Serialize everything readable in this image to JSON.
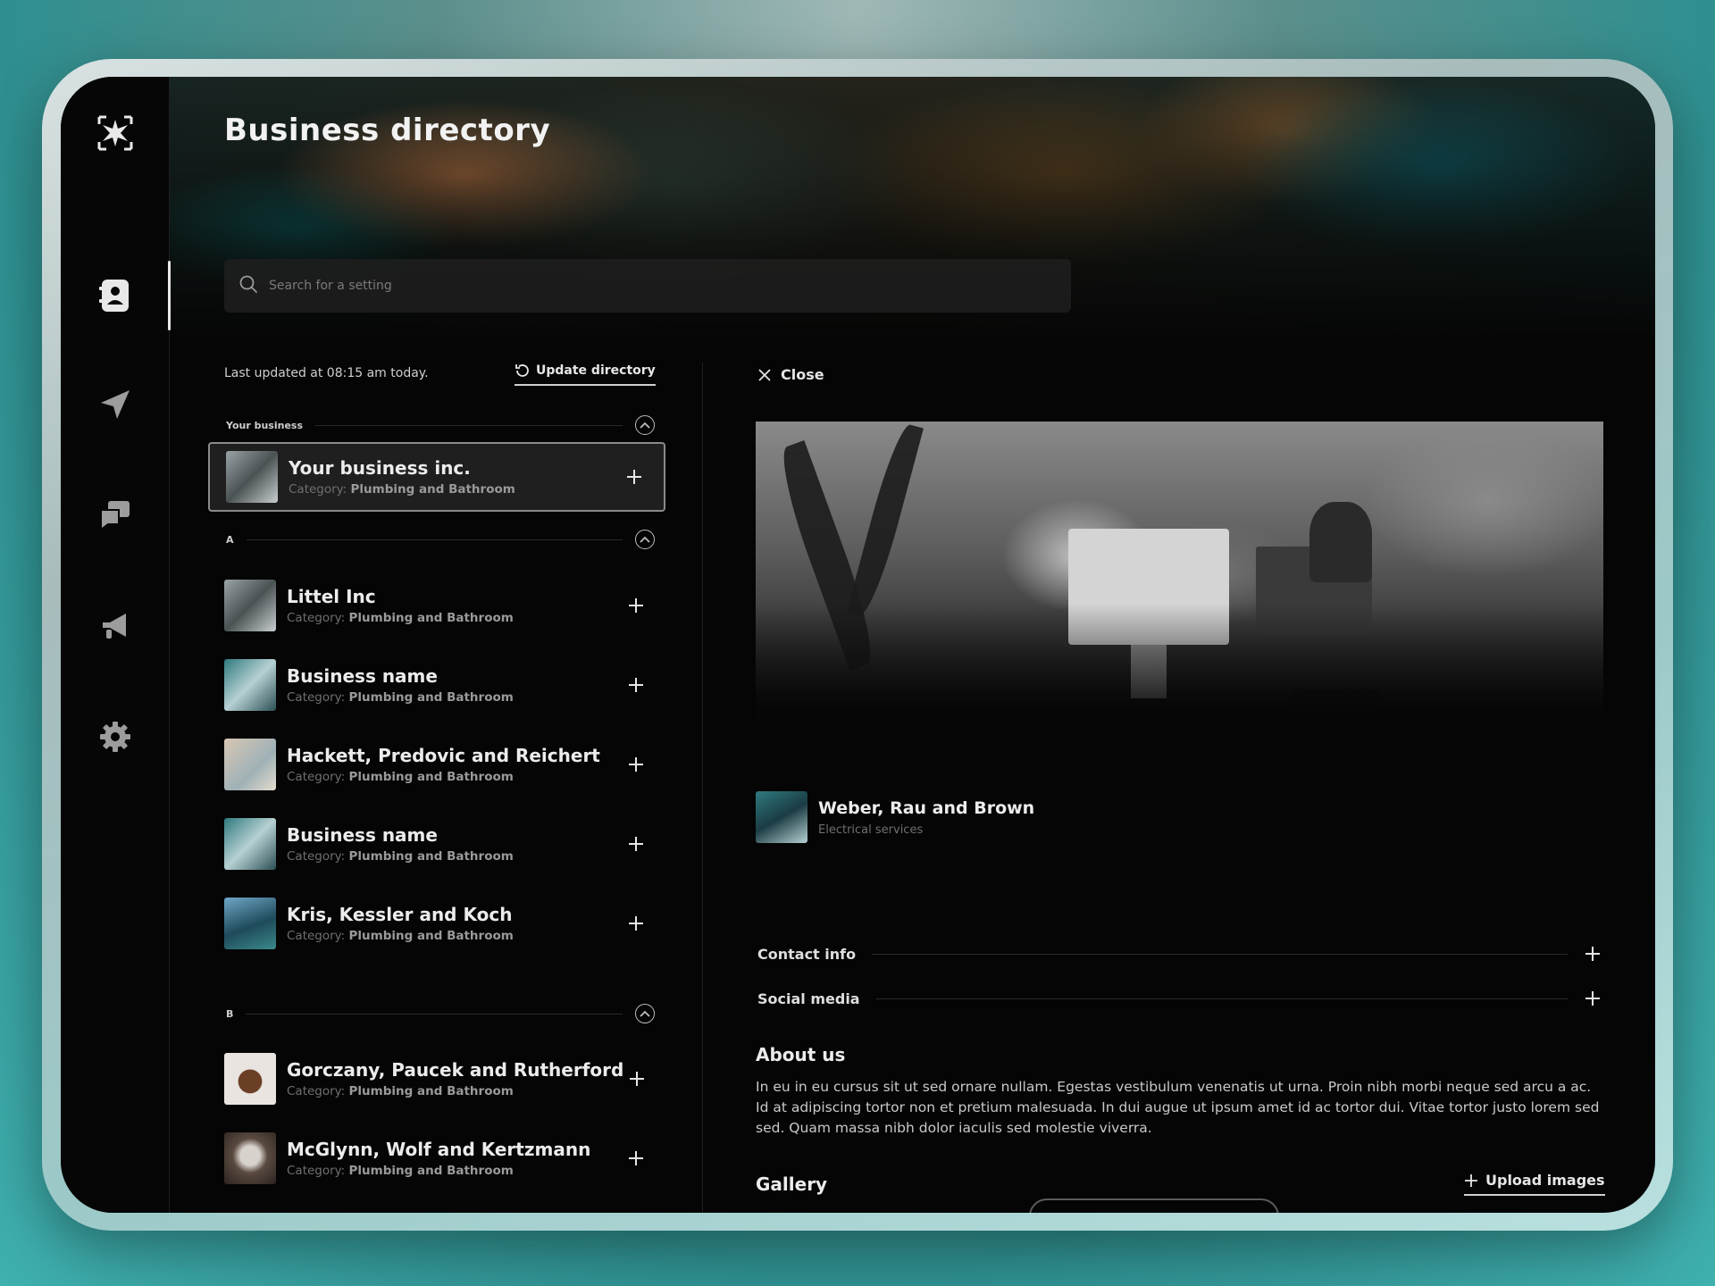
{
  "app": {
    "title": "Business directory"
  },
  "colors": {
    "accent": "#e8e8e8",
    "background": "#050505",
    "muted": "#6f6f6f"
  },
  "sidebar": {
    "items": [
      {
        "icon": "contacts-icon",
        "active": true
      },
      {
        "icon": "send-icon",
        "active": false
      },
      {
        "icon": "chat-icon",
        "active": false
      },
      {
        "icon": "megaphone-icon",
        "active": false
      },
      {
        "icon": "gear-icon",
        "active": false
      }
    ]
  },
  "search": {
    "placeholder": "Search for a setting"
  },
  "list": {
    "last_updated": "Last updated at 08:15 am today.",
    "update_label": "Update directory",
    "category_prefix": "Category:",
    "sections": [
      {
        "label": "Your business",
        "items": [
          {
            "name": "Your business inc.",
            "category": "Plumbing and Bathroom",
            "selected": true
          }
        ]
      },
      {
        "label": "A",
        "items": [
          {
            "name": "Littel Inc",
            "category": "Plumbing and Bathroom"
          },
          {
            "name": "Business name",
            "category": "Plumbing and Bathroom"
          },
          {
            "name": "Hackett, Predovic and Reichert",
            "category": "Plumbing and Bathroom"
          },
          {
            "name": "Business name",
            "category": "Plumbing and Bathroom"
          },
          {
            "name": "Kris, Kessler and Koch",
            "category": "Plumbing and Bathroom"
          }
        ]
      },
      {
        "label": "B",
        "items": [
          {
            "name": "Gorczany, Paucek and Rutherford",
            "category": "Plumbing and Bathroom"
          },
          {
            "name": "McGlynn, Wolf and Kertzmann",
            "category": "Plumbing and Bathroom"
          }
        ]
      }
    ]
  },
  "detail": {
    "close_label": "Close",
    "name": "Weber, Rau and Brown",
    "subtitle": "Electrical services",
    "accordions": [
      "Contact info",
      "Social media"
    ],
    "about_title": "About us",
    "about_text": "In eu in eu cursus sit ut sed ornare nullam. Egestas vestibulum venenatis ut urna. Proin nibh morbi neque sed arcu a ac. Id at adipiscing tortor non et pretium malesuada. In dui augue ut ipsum amet id ac tortor dui. Vitae tortor justo lorem sed sed. Quam massa nibh dolor iaculis sed molestie viverra.",
    "gallery_title": "Gallery",
    "upload_label": "Upload images"
  }
}
